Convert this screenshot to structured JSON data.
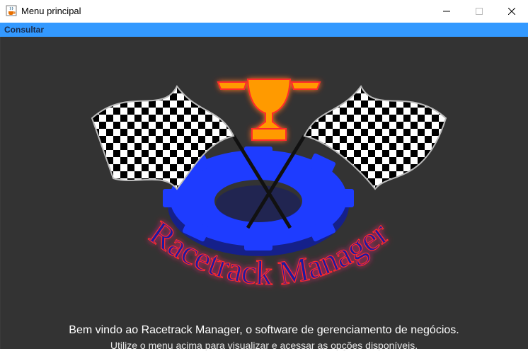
{
  "window": {
    "title": "Menu principal",
    "icon": "java-cup-icon",
    "controls": {
      "minimize": "minimize-icon",
      "maximize": "maximize-icon",
      "close": "close-icon"
    }
  },
  "menubar": {
    "items": [
      {
        "label": "Consultar"
      }
    ]
  },
  "logo": {
    "text": "Racetrack Manager"
  },
  "welcome": {
    "line1": "Bem vindo ao Racetrack Manager, o software de gerenciamento de negócios.",
    "line2": "Utilize o menu acima para visualizar e acessar as opções disponíveis."
  },
  "colors": {
    "menubar": "#3399ff",
    "background": "#333333",
    "gear": "#1e3cff",
    "trophy": "#ff9a00",
    "logo_text": "#1a1aa0",
    "glow": "#ff2a2a"
  }
}
